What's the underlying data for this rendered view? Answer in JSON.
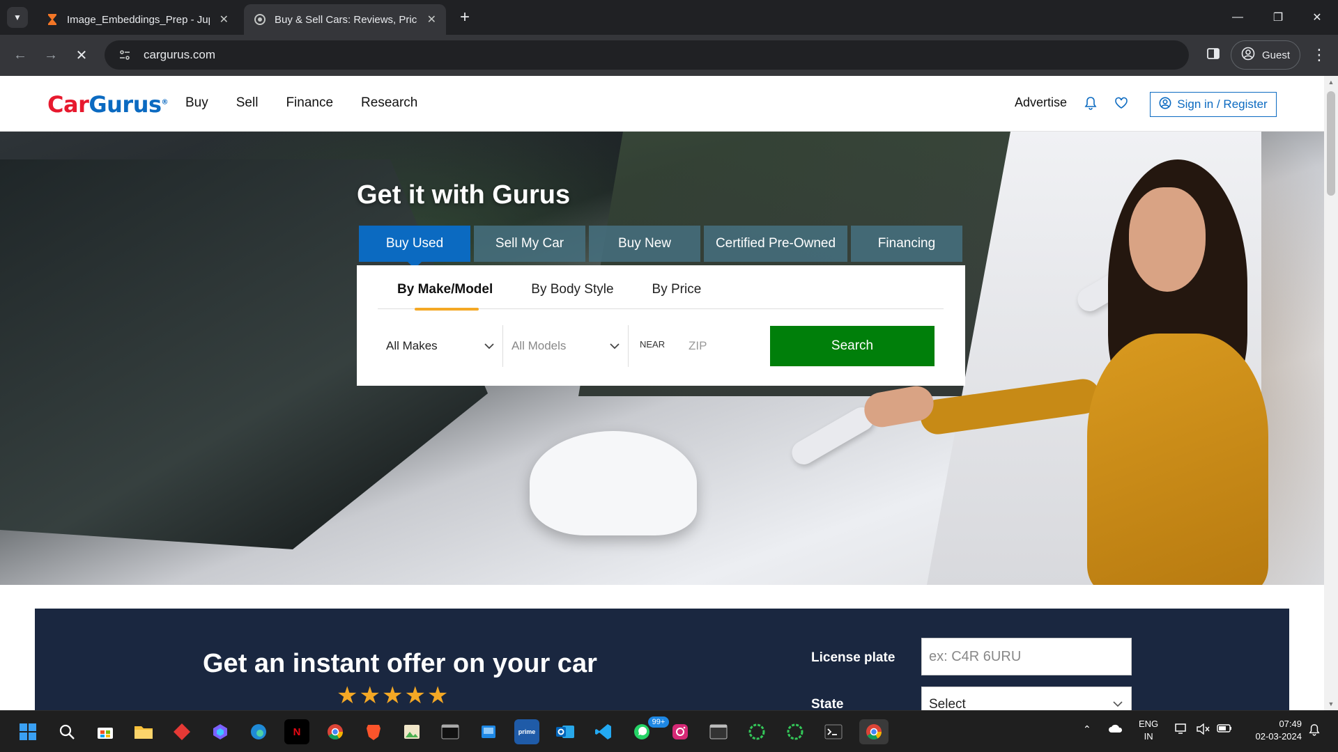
{
  "browser": {
    "tabs": [
      {
        "title": "Image_Embeddings_Prep - Jupyter",
        "icon": "hourglass-icon",
        "active": false
      },
      {
        "title": "Buy & Sell Cars: Reviews, Prices",
        "icon": "cargurus-favicon",
        "active": true
      }
    ],
    "url": "cargurus.com",
    "profile_label": "Guest"
  },
  "site": {
    "logo_car": "Car",
    "logo_gurus": "Gurus",
    "logo_mark": "®",
    "nav": [
      "Buy",
      "Sell",
      "Finance",
      "Research"
    ],
    "advertise": "Advertise",
    "signin": "Sign in / Register"
  },
  "hero": {
    "title": "Get it with Gurus",
    "tabs": [
      "Buy Used",
      "Sell My Car",
      "Buy New",
      "Certified Pre-Owned",
      "Financing"
    ],
    "sub_tabs": [
      "By Make/Model",
      "By Body Style",
      "By Price"
    ],
    "make_value": "All Makes",
    "model_value": "All Models",
    "near_label": "NEAR",
    "zip_placeholder": "ZIP",
    "search_label": "Search"
  },
  "offer": {
    "title": "Get an instant offer on your car",
    "stars": "★★★★★",
    "plate_label": "License plate",
    "plate_placeholder": "ex: C4R 6URU",
    "state_label": "State",
    "state_value": "Select"
  },
  "taskbar": {
    "whatsapp_badge": "99+",
    "lang_top": "ENG",
    "lang_bottom": "IN",
    "time": "07:49",
    "date": "02-03-2024"
  },
  "colors": {
    "brand_blue": "#0b6ac1",
    "brand_red": "#e7192e",
    "search_green": "#007f0a",
    "offer_navy": "#1a2740",
    "accent_yellow": "#f4a825"
  }
}
